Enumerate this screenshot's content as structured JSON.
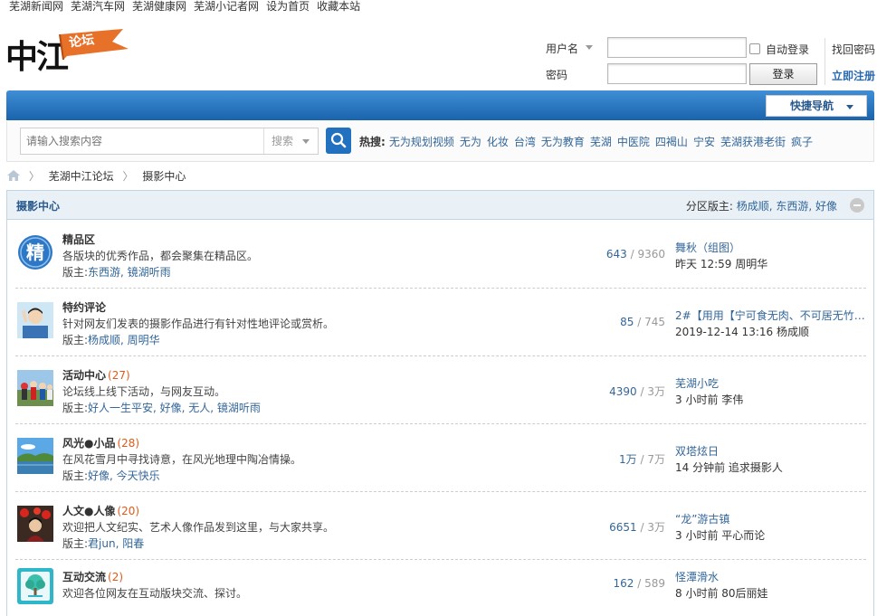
{
  "topbar": {
    "links": [
      "芜湖新闻网",
      "芜湖汽车网",
      "芜湖健康网",
      "芜湖小记者网",
      "设为首页",
      "收藏本站"
    ]
  },
  "logo": {
    "main": "中江",
    "flag": "论坛",
    "flag_color": "#e8712a"
  },
  "login": {
    "username_label": "用户名",
    "password_label": "密码",
    "auto_login": "自动登录",
    "login_button": "登录",
    "find_password": "找回密码",
    "register": "立即注册"
  },
  "nav": {
    "quick_nav": "快捷导航",
    "bar_color": "#1d67b2"
  },
  "search": {
    "placeholder": "请输入搜索内容",
    "type": "搜索",
    "hot_label": "热搜:",
    "hot_terms": [
      "无为规划视频",
      "无为",
      "化妆",
      "台湾",
      "无为教育",
      "芜湖",
      "中医院",
      "四褐山",
      "宁安",
      "芜湖获港老街",
      "疯子"
    ]
  },
  "breadcrumb": {
    "home_icon": "home-icon",
    "items": [
      "芜湖中江论坛",
      "摄影中心"
    ]
  },
  "forum_group": {
    "title": "摄影中心",
    "moderators_label": "分区版主:",
    "moderators": "杨成顺, 东西游, 好像"
  },
  "forums": [
    {
      "name": "精品区",
      "count": "",
      "desc": "各版块的优秀作品，都会聚集在精品区。",
      "mod_label": "版主:",
      "mods": "东西游, 镜湖听雨",
      "threads": "643",
      "posts": "9360",
      "last_title": "舞秋（组图）",
      "last_time": "昨天 12:59",
      "last_user": "周明华",
      "icon": "jing-badge-icon"
    },
    {
      "name": "特约评论",
      "count": "",
      "desc": "针对网友们发表的摄影作品进行有针对性地评论或赏析。",
      "mod_label": "版主:",
      "mods": "杨成顺, 周明华",
      "threads": "85",
      "posts": "745",
      "last_title": "2#【用用【宁可食无肉、不可居无竹】...",
      "last_time": "2019-12-14 13:16",
      "last_user": "杨成顺",
      "icon": "commentator-icon"
    },
    {
      "name": "活动中心",
      "count": "(27)",
      "desc": "论坛线上线下活动，与网友互动。",
      "mod_label": "版主:",
      "mods": "好人一生平安, 好像, 无人, 镜湖听雨",
      "threads": "4390",
      "posts": "3万",
      "last_title": "芜湖小吃",
      "last_time": "3 小时前",
      "last_user": "李伟",
      "icon": "event-photo-icon"
    },
    {
      "name": "风光●小品",
      "count": "(28)",
      "desc": "在风花雪月中寻找诗意，在风光地理中陶冶情操。",
      "mod_label": "版主:",
      "mods": "好像, 今天快乐",
      "threads": "1万",
      "posts": "7万",
      "last_title": "双塔炫日",
      "last_time": "14 分钟前",
      "last_user": "追求摄影人",
      "icon": "landscape-photo-icon"
    },
    {
      "name": "人文●人像",
      "count": "(20)",
      "desc": "欢迎把人文纪实、艺术人像作品发到这里，与大家共享。",
      "mod_label": "版主:",
      "mods": "君jun, 阳春",
      "threads": "6651",
      "posts": "3万",
      "last_title": "“龙”游古镇",
      "last_time": "3 小时前",
      "last_user": "平心而论",
      "icon": "portrait-photo-icon"
    },
    {
      "name": "互动交流",
      "count": "(2)",
      "desc": "欢迎各位网友在互动版块交流、探讨。",
      "mod_label": "",
      "mods": "",
      "threads": "162",
      "posts": "589",
      "last_title": "怪潭滑水",
      "last_time": "8 小时前",
      "last_user": "80后丽娃",
      "icon": "tree-logo-icon"
    }
  ]
}
